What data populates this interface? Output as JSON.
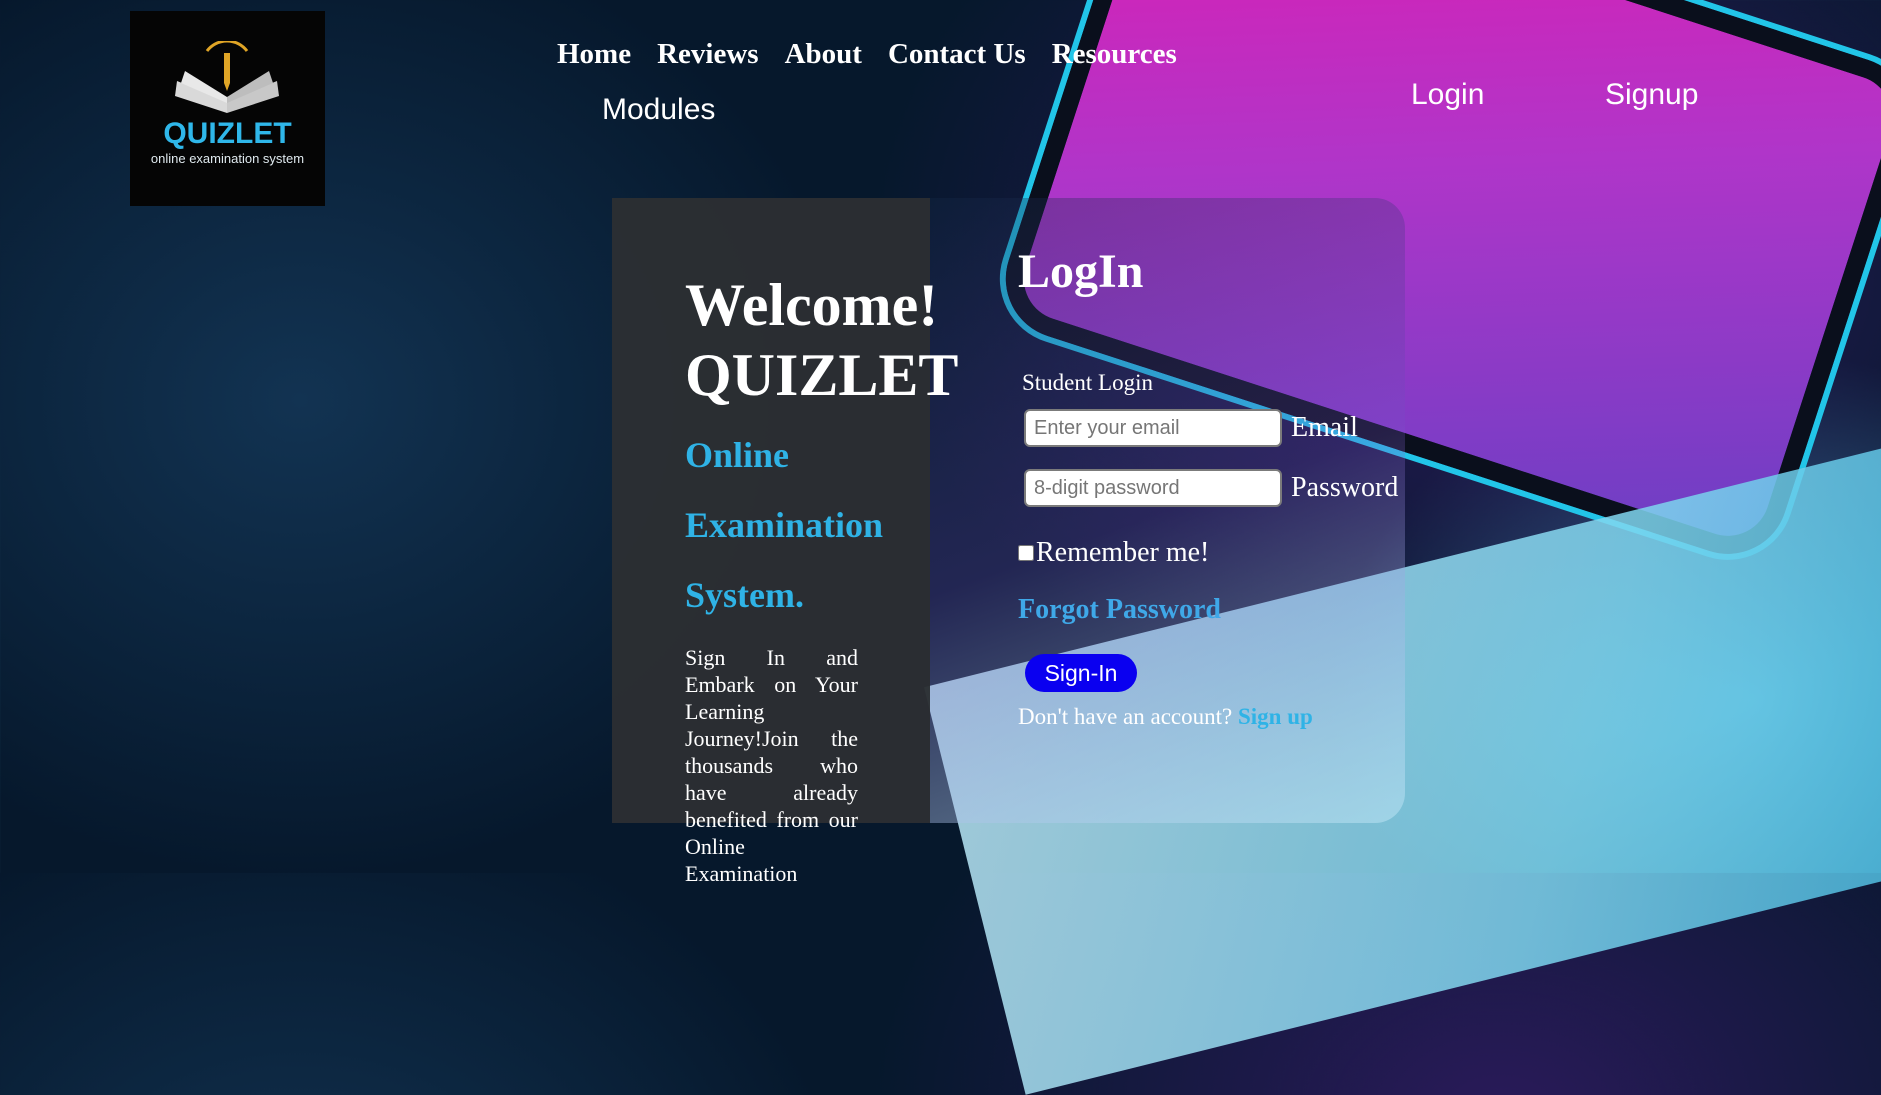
{
  "logo": {
    "name": "QUIZLET",
    "tagline": "online examination system"
  },
  "nav": {
    "items": [
      {
        "label": "Home"
      },
      {
        "label": "Reviews"
      },
      {
        "label": "About"
      },
      {
        "label": "Contact Us"
      },
      {
        "label": "Resources"
      }
    ],
    "modules_label": "Modules"
  },
  "auth": {
    "login_label": "Login",
    "signup_label": "Signup"
  },
  "hero": {
    "welcome_line1": "Welcome!",
    "welcome_line2": "QUIZLET",
    "subtitle": "Online Examination System.",
    "description": "Sign In and Embark on Your Learning Journey!Join the thousands who have already benefited from our Online Examination"
  },
  "login_form": {
    "title": "LogIn",
    "student_login_label": "Student Login",
    "email_placeholder": "Enter your email",
    "email_label": "Email",
    "password_placeholder": "8-digit password",
    "password_label": "Password",
    "remember_label": "Remember me!",
    "forgot_label": "Forgot Password",
    "signin_label": "Sign-In",
    "no_account_text": "Don't have an account? ",
    "signup_link": "Sign up"
  },
  "colors": {
    "accent": "#2fb3e6",
    "button": "#0a00f0",
    "card_dark": "#2b2e33"
  }
}
